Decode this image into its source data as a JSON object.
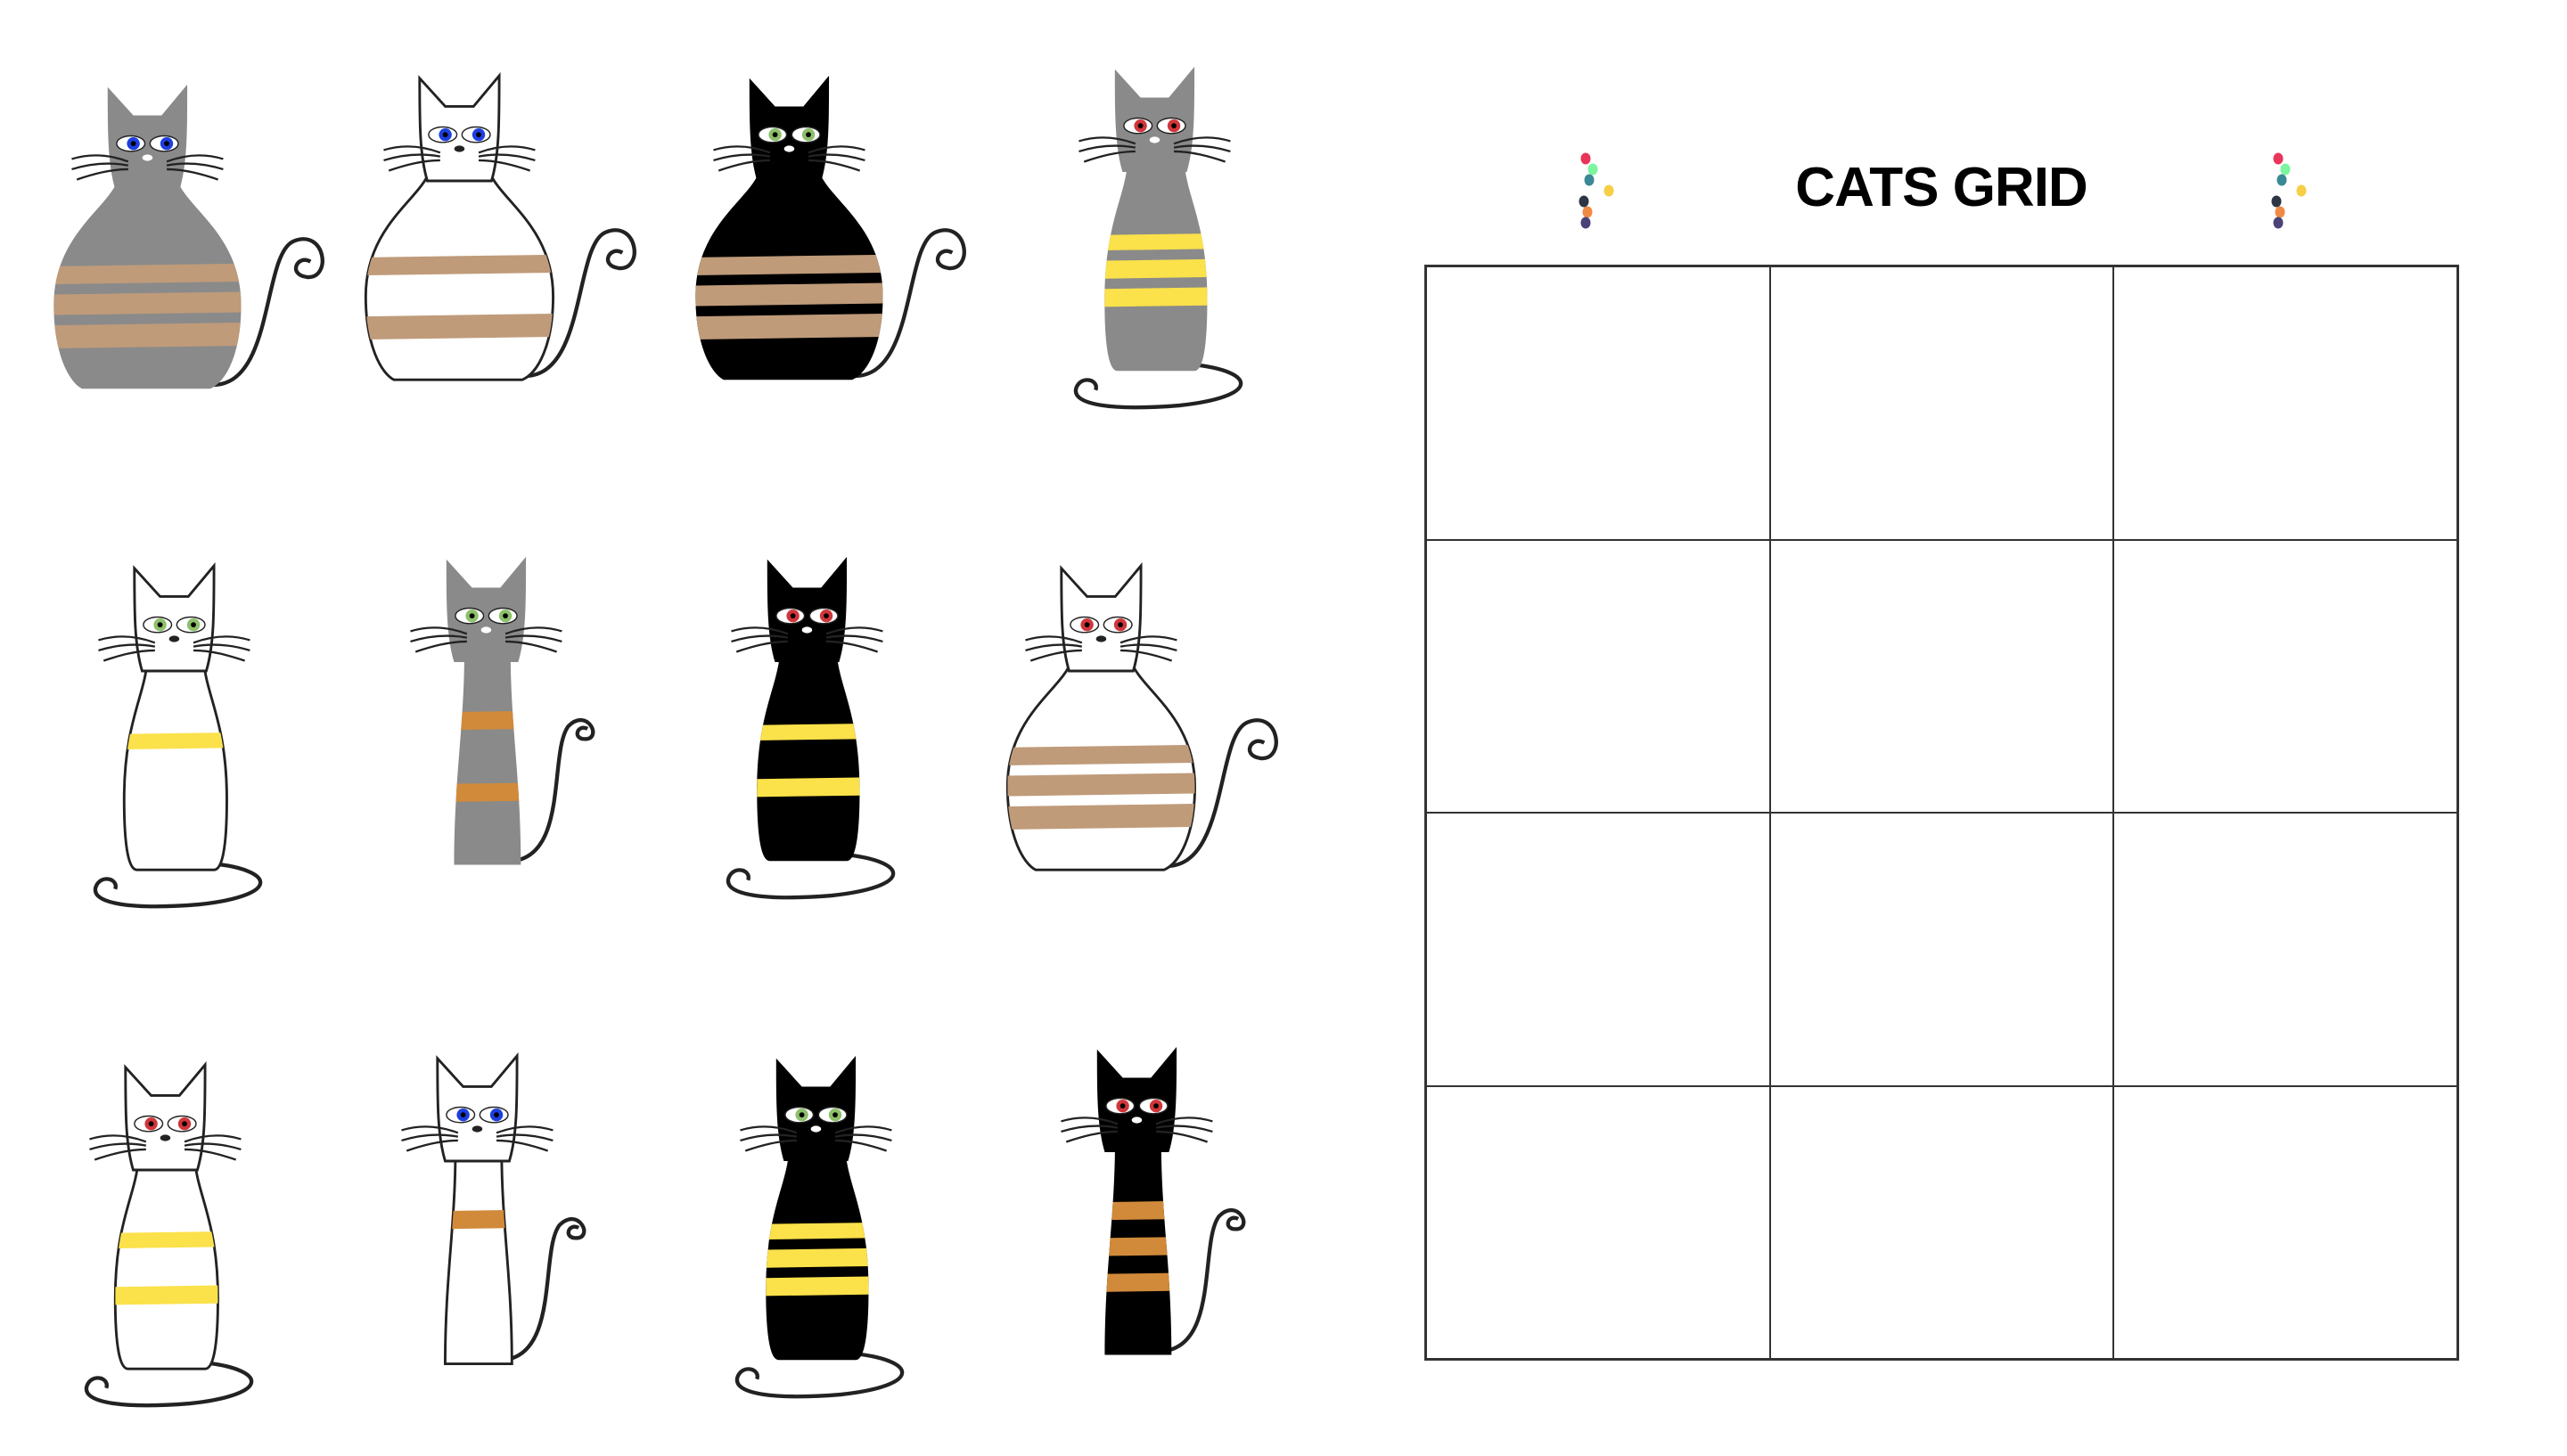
{
  "title": "CATS GRID",
  "colors": {
    "gray": "#8a8a8a",
    "white": "#ffffff",
    "black": "#000000",
    "tan": "#bf9b7a",
    "yellow": "#fbe14a",
    "orange": "#d08a3a",
    "blue": "#1d3fe0",
    "green": "#8dc06a",
    "red": "#d0363a",
    "grid_line": "#333333"
  },
  "decor_dots": [
    "#e8355a",
    "#7cf5a0",
    "#3a8896",
    "#f7ce45",
    "#2e3545",
    "#ef8a45",
    "#4a4278"
  ],
  "grid": {
    "rows": 4,
    "cols": 3
  },
  "cats": [
    {
      "fur": "gray",
      "stripe": "tan",
      "stripes": 3,
      "eyes": "blue",
      "shape": "fat",
      "tail": "side"
    },
    {
      "fur": "white",
      "stripe": "tan",
      "stripes": 2,
      "eyes": "blue",
      "shape": "fat",
      "tail": "side"
    },
    {
      "fur": "black",
      "stripe": "tan",
      "stripes": 3,
      "eyes": "green",
      "shape": "fat",
      "tail": "side"
    },
    {
      "fur": "gray",
      "stripe": "yellow",
      "stripes": 3,
      "eyes": "red",
      "shape": "medium",
      "tail": "curl"
    },
    {
      "fur": "white",
      "stripe": "yellow",
      "stripes": 1,
      "eyes": "green",
      "shape": "medium",
      "tail": "curl"
    },
    {
      "fur": "gray",
      "stripe": "orange",
      "stripes": 2,
      "eyes": "green",
      "shape": "slim",
      "tail": "side"
    },
    {
      "fur": "black",
      "stripe": "yellow",
      "stripes": 2,
      "eyes": "red",
      "shape": "medium",
      "tail": "curl"
    },
    {
      "fur": "white",
      "stripe": "tan",
      "stripes": 3,
      "eyes": "red",
      "shape": "fat",
      "tail": "side"
    },
    {
      "fur": "white",
      "stripe": "yellow",
      "stripes": 2,
      "eyes": "red",
      "shape": "medium",
      "tail": "curl"
    },
    {
      "fur": "white",
      "stripe": "orange",
      "stripes": 1,
      "eyes": "blue",
      "shape": "slim",
      "tail": "side"
    },
    {
      "fur": "black",
      "stripe": "yellow",
      "stripes": 3,
      "eyes": "green",
      "shape": "medium",
      "tail": "curl"
    },
    {
      "fur": "black",
      "stripe": "orange",
      "stripes": 3,
      "eyes": "red",
      "shape": "slim",
      "tail": "side"
    }
  ]
}
